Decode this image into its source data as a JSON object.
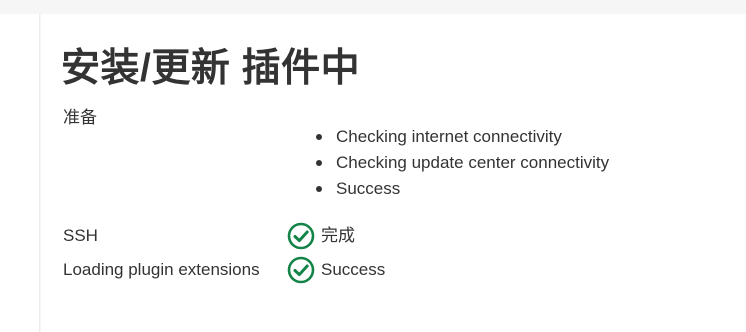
{
  "page": {
    "title": "安装/更新 插件中"
  },
  "preparation": {
    "label": "准备",
    "steps": [
      "Checking internet connectivity",
      "Checking update center connectivity",
      "Success"
    ]
  },
  "jobs": [
    {
      "label": "SSH",
      "status": "完成",
      "icon": "check-circle-icon"
    },
    {
      "label": "Loading plugin extensions",
      "status": "Success",
      "icon": "check-circle-icon"
    }
  ],
  "colors": {
    "success": "#138347",
    "text": "#333333"
  }
}
